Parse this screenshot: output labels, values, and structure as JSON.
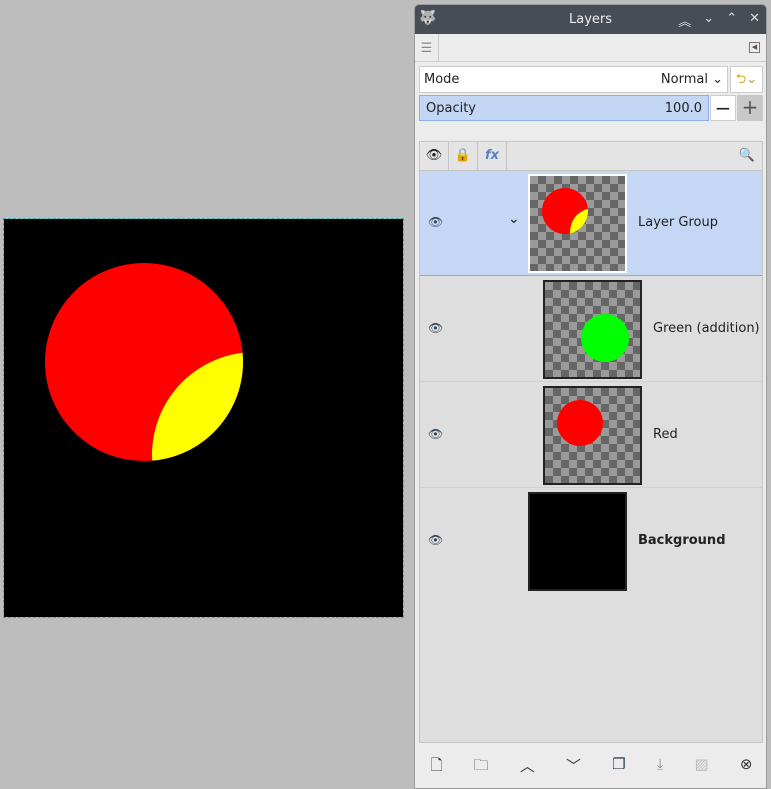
{
  "panel": {
    "title": "Layers",
    "mode_label": "Mode",
    "mode_value": "Normal",
    "opacity_label": "Opacity",
    "opacity_value": "100.0",
    "minus": "−",
    "plus": "+"
  },
  "layers": [
    {
      "name": "Layer Group",
      "selected": true,
      "expanded": true
    },
    {
      "name": "Green (addition)"
    },
    {
      "name": "Red"
    },
    {
      "name": "Background",
      "bold": true
    }
  ],
  "colors": {
    "red": "#ff0000",
    "green": "#00ff00",
    "yellow": "#ffff00",
    "selection": "#c4d8f5"
  }
}
